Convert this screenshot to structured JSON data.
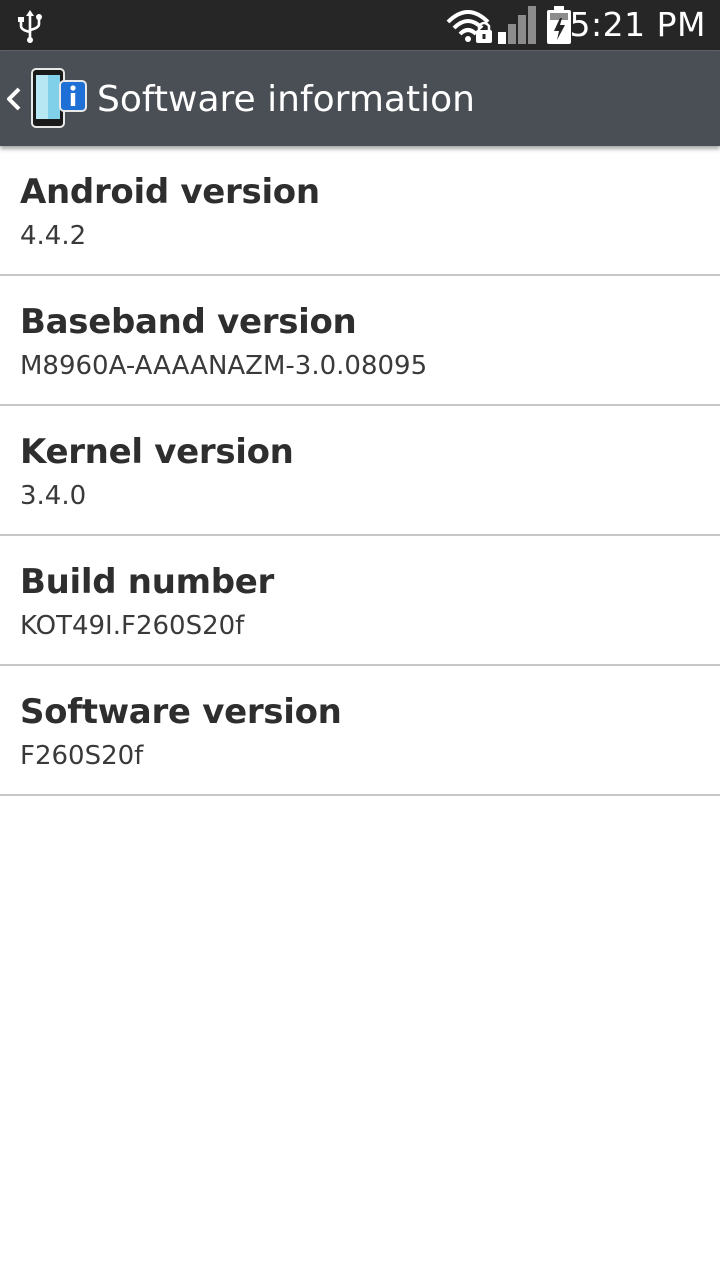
{
  "status_bar": {
    "time": "5:21 PM",
    "icons": [
      "usb-icon",
      "wifi-locked-icon",
      "signal-icon",
      "battery-charging-icon"
    ]
  },
  "action_bar": {
    "title": "Software information",
    "back_icon": "chevron-left-icon",
    "app_icon": "phone-info-icon"
  },
  "items": [
    {
      "label": "Android version",
      "value": "4.4.2"
    },
    {
      "label": "Baseband version",
      "value": "M8960A-AAAANAZM-3.0.08095"
    },
    {
      "label": "Kernel version",
      "value": "3.4.0"
    },
    {
      "label": "Build number",
      "value": "KOT49I.F260S20f"
    },
    {
      "label": "Software version",
      "value": "F260S20f"
    }
  ],
  "colors": {
    "status_bar_bg": "#262626",
    "action_bar_bg": "#4a4f56",
    "divider": "#c7c7c7",
    "background": "#ffffff"
  }
}
